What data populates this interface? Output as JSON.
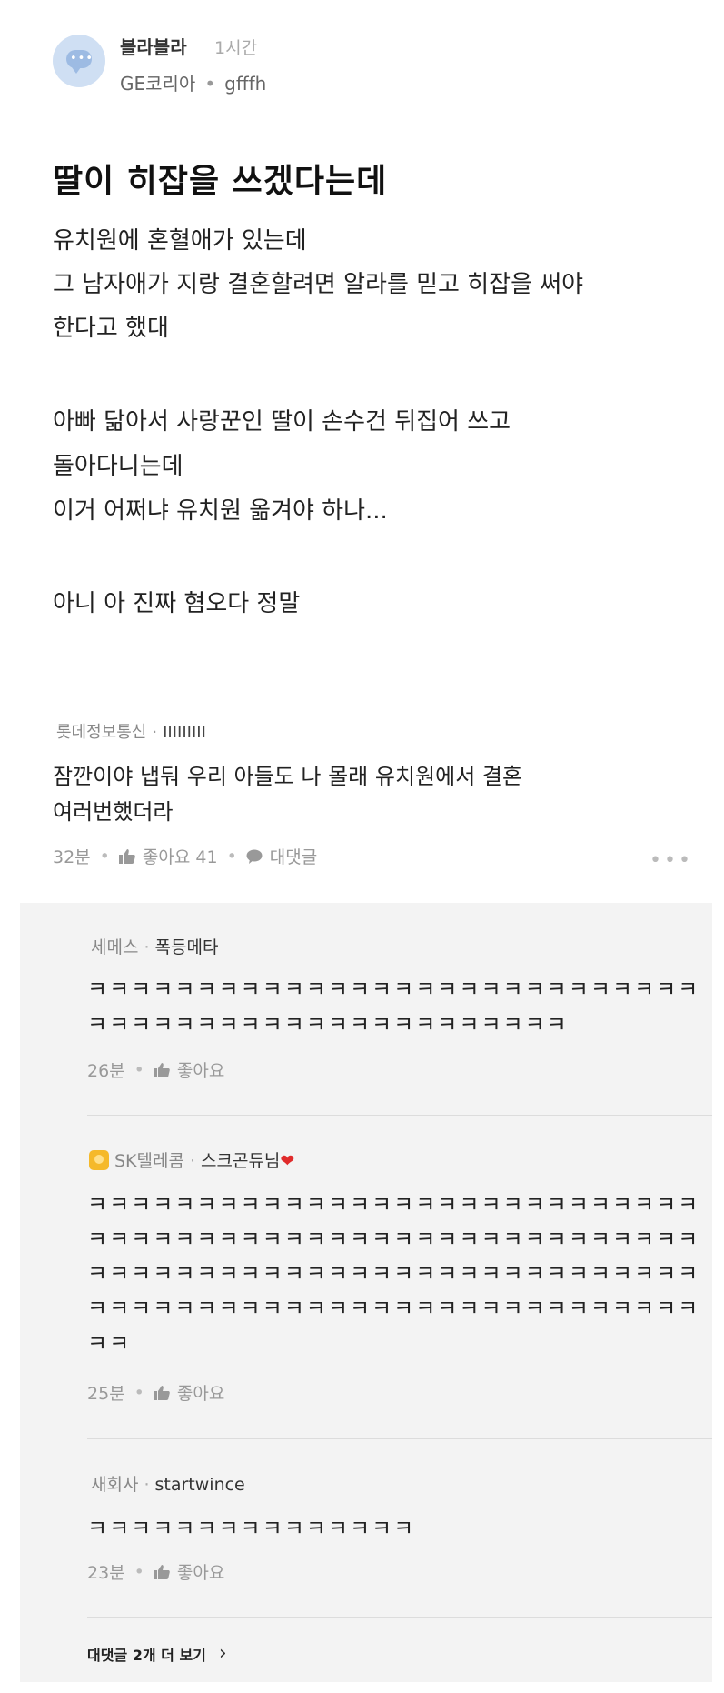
{
  "post": {
    "author": "블라블라",
    "time": "1시간",
    "company": "GE코리아",
    "nickname": "gfffh",
    "title": "딸이 히잡을 쓰겠다는데",
    "body_lines": [
      "유치원에 혼혈애가 있는데",
      "그 남자애가 지랑 결혼할려면 알라를 믿고 히잡을 써야",
      "한다고 했대",
      "아빠 닮아서 사랑꾼인 딸이 손수건 뒤집어 쓰고",
      "돌아다니는데",
      "이거 어쩌냐 유치원 옮겨야 하나...",
      "아니 아 진짜 혐오다 정말"
    ]
  },
  "comment": {
    "company": "롯데정보통신",
    "nickname": "IIIIIIIII",
    "lines": [
      "잠깐이야 냅둬 우리 아들도 나 몰래 유치원에서 결혼",
      "여러번했더라"
    ],
    "time": "32분",
    "like_label": "좋아요 41",
    "reply_label": "대댓글"
  },
  "replies": [
    {
      "company": "세메스",
      "nickname": "폭등메타",
      "lines": [
        "ㅋㅋㅋㅋㅋㅋㅋㅋㅋㅋㅋㅋㅋㅋㅋㅋㅋㅋㅋㅋㅋㅋㅋㅋㅋㅋㅋㅋ",
        "ㅋㅋㅋㅋㅋㅋㅋㅋㅋㅋㅋㅋㅋㅋㅋㅋㅋㅋㅋㅋㅋㅋ"
      ],
      "time": "26분",
      "like_label": "좋아요"
    },
    {
      "company": "SK텔레콤",
      "nickname": "스크곤듀님",
      "heart": "❤",
      "lines": [
        "ㅋㅋㅋㅋㅋㅋㅋㅋㅋㅋㅋㅋㅋㅋㅋㅋㅋㅋㅋㅋㅋㅋㅋㅋㅋㅋㅋㅋ",
        "ㅋㅋㅋㅋㅋㅋㅋㅋㅋㅋㅋㅋㅋㅋㅋㅋㅋㅋㅋㅋㅋㅋㅋㅋㅋㅋㅋㅋ",
        "ㅋㅋㅋㅋㅋㅋㅋㅋㅋㅋㅋㅋㅋㅋㅋㅋㅋㅋㅋㅋㅋㅋㅋㅋㅋㅋㅋㅋ",
        "ㅋㅋㅋㅋㅋㅋㅋㅋㅋㅋㅋㅋㅋㅋㅋㅋㅋㅋㅋㅋㅋㅋㅋㅋㅋㅋㅋㅋ",
        "ㅋㅋ"
      ],
      "time": "25분",
      "like_label": "좋아요"
    },
    {
      "company": "새회사",
      "nickname": "startwince",
      "lines": [
        "ㅋㅋㅋㅋㅋㅋㅋㅋㅋㅋㅋㅋㅋㅋㅋ"
      ],
      "time": "23분",
      "like_label": "좋아요"
    }
  ],
  "see_more": "대댓글 2개 더 보기",
  "colors": {
    "avatar_bg": "#cfdff3",
    "reply_bg": "#f3f3f3",
    "badge": "#f5b92a",
    "heart": "#e02b2b"
  }
}
